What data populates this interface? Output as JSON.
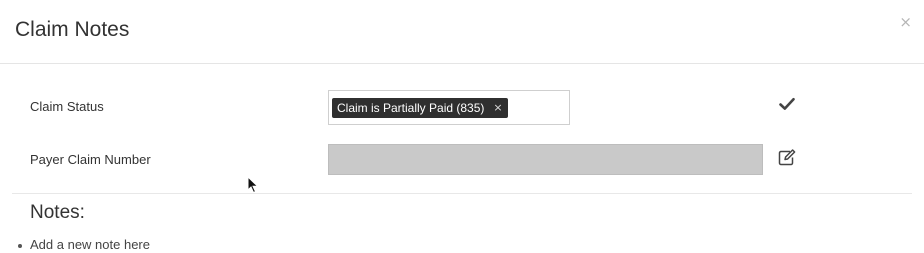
{
  "modal": {
    "title": "Claim Notes",
    "close_symbol": "×"
  },
  "fields": {
    "claim_status": {
      "label": "Claim Status",
      "tag_text": "Claim is Partially Paid (835)",
      "tag_remove_symbol": "×",
      "action_icon": "check-icon"
    },
    "payer_claim_number": {
      "label": "Payer Claim Number",
      "value": "",
      "action_icon": "edit-icon"
    }
  },
  "notes": {
    "title": "Notes:",
    "add_note_text": "Add a new note here"
  },
  "colors": {
    "tag_background": "#2f2f2f",
    "disabled_input": "#c9c9c9"
  }
}
